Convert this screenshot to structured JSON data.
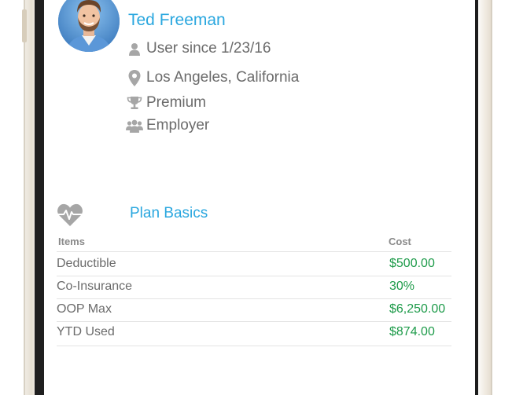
{
  "profile": {
    "name": "Ted Freeman",
    "member_since": "User since 1/23/16",
    "location": "Los Angeles, California",
    "tier": "Premium",
    "group": "Employer"
  },
  "icons": {
    "member_since": "user-icon",
    "location": "map-pin-icon",
    "tier": "trophy-icon",
    "group": "users-icon",
    "plan": "heartbeat-icon"
  },
  "plan": {
    "title": "Plan Basics",
    "columns": {
      "items": "Items",
      "cost": "Cost"
    },
    "rows": [
      {
        "item": "Deductible",
        "cost": "$500.00"
      },
      {
        "item": "Co-Insurance",
        "cost": "30%"
      },
      {
        "item": "OOP Max",
        "cost": "$6,250.00"
      },
      {
        "item": "YTD Used",
        "cost": "$874.00"
      }
    ]
  },
  "colors": {
    "accent": "#2aa7df",
    "cost": "#1e9b4a",
    "text": "#6b6b6b",
    "icon": "#a6a6a6"
  }
}
